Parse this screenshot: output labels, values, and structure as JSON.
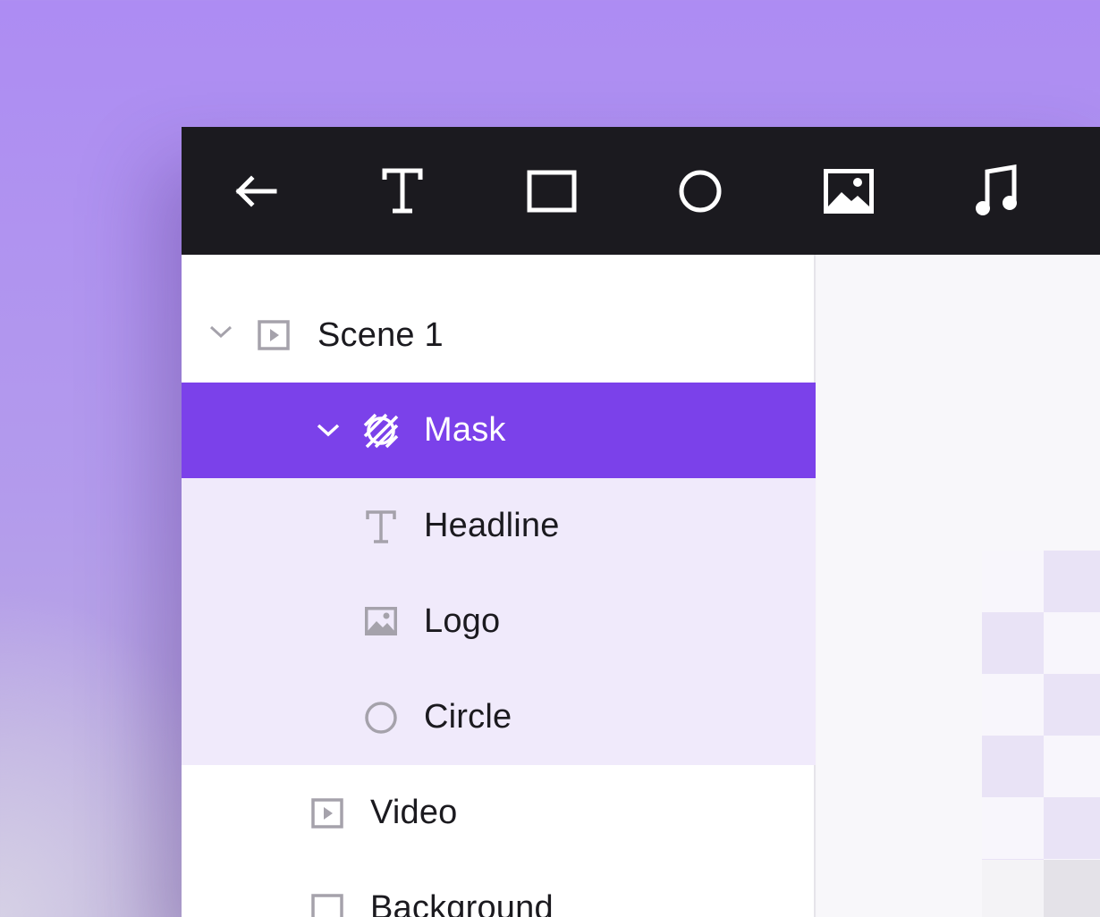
{
  "toolbar": {
    "tools": [
      {
        "icon": "arrow-left-icon",
        "name": "back"
      },
      {
        "icon": "text-icon",
        "name": "text"
      },
      {
        "icon": "rectangle-icon",
        "name": "rectangle"
      },
      {
        "icon": "circle-icon",
        "name": "circle"
      },
      {
        "icon": "image-icon",
        "name": "image"
      },
      {
        "icon": "music-icon",
        "name": "audio"
      }
    ]
  },
  "layers": {
    "items": [
      {
        "label": "Scene 1",
        "icon": "scene-icon",
        "expanded": true,
        "state": "normal"
      },
      {
        "label": "Mask",
        "icon": "mask-icon",
        "expanded": true,
        "state": "selected"
      },
      {
        "label": "Headline",
        "icon": "text-icon",
        "state": "child"
      },
      {
        "label": "Logo",
        "icon": "image-icon",
        "state": "child"
      },
      {
        "label": "Circle",
        "icon": "circle-icon",
        "state": "child"
      },
      {
        "label": "Video",
        "icon": "video-icon",
        "state": "normal"
      },
      {
        "label": "Background",
        "icon": "rectangle-icon",
        "state": "normal"
      }
    ]
  },
  "colors": {
    "accent": "#7b41ea",
    "toolbar": "#1b1a1f",
    "child_highlight": "#f0eafb",
    "background_gradient_top": "#ad8cf3"
  }
}
